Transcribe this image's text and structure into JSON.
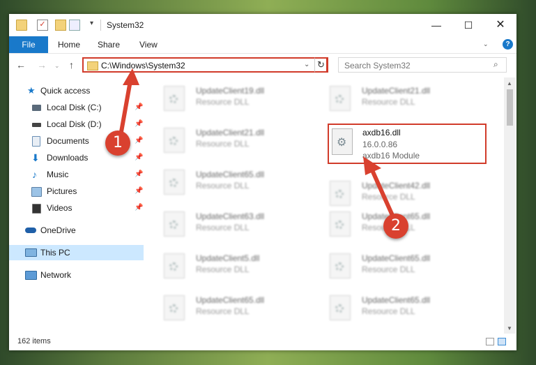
{
  "window": {
    "title": "System32",
    "controls": {
      "minimize": "—",
      "maximize": "☐",
      "close": "✕"
    }
  },
  "ribbon": {
    "tabs": [
      "File",
      "Home",
      "Share",
      "View"
    ],
    "help": "?"
  },
  "navigation": {
    "back": "←",
    "forward": "→",
    "recent": "⌄",
    "up": "↑",
    "address": "C:\\Windows\\System32",
    "address_drop": "⌄",
    "refresh": "↻",
    "search_placeholder": "Search System32"
  },
  "sidebar": {
    "items": [
      {
        "label": "Quick access",
        "icon": "star-icon",
        "pinned": false
      },
      {
        "label": "Local Disk (C:)",
        "icon": "drive-icon",
        "pinned": true
      },
      {
        "label": "Local Disk (D:)",
        "icon": "drive-icon",
        "pinned": true
      },
      {
        "label": "Documents",
        "icon": "documents-icon",
        "pinned": true
      },
      {
        "label": "Downloads",
        "icon": "download-icon",
        "pinned": true
      },
      {
        "label": "Music",
        "icon": "music-icon",
        "pinned": true
      },
      {
        "label": "Pictures",
        "icon": "pictures-icon",
        "pinned": true
      },
      {
        "label": "Videos",
        "icon": "videos-icon",
        "pinned": true
      },
      {
        "label": "OneDrive",
        "icon": "cloud-icon",
        "pinned": false
      },
      {
        "label": "This PC",
        "icon": "computer-icon",
        "pinned": false,
        "selected": true
      },
      {
        "label": "Network",
        "icon": "network-icon",
        "pinned": false
      }
    ]
  },
  "files": {
    "left_column": [
      {
        "name": "UpdateClient19.dll",
        "type": "Resource DLL"
      },
      {
        "name": "UpdateClient21.dll",
        "type": "Resource DLL"
      },
      {
        "name": "UpdateClient65.dll",
        "type": "Resource DLL"
      },
      {
        "name": "UpdateClient63.dll",
        "type": "Resource DLL"
      },
      {
        "name": "UpdateClient5.dll",
        "type": "Resource DLL"
      },
      {
        "name": "UpdateClient65.dll",
        "type": "Resource DLL"
      }
    ],
    "right_column": [
      {
        "name": "UpdateClient21.dll",
        "type": "Resource DLL"
      },
      {
        "name": "UpdateClient42.dll",
        "type": "Resource DLL"
      },
      {
        "name": "UpdateClient65.dll",
        "type": "Resource DLL"
      },
      {
        "name": "UpdateClient65.dll",
        "type": "Resource DLL"
      },
      {
        "name": "UpdateClient65.dll",
        "type": "Resource DLL"
      }
    ],
    "highlighted": {
      "name": "axdb16.dll",
      "version": "16.0.0.86",
      "description": "axdb16 Module"
    }
  },
  "status": {
    "item_count": "162 items"
  },
  "annotations": {
    "badge1": "1",
    "badge2": "2",
    "color": "#d9412f"
  }
}
